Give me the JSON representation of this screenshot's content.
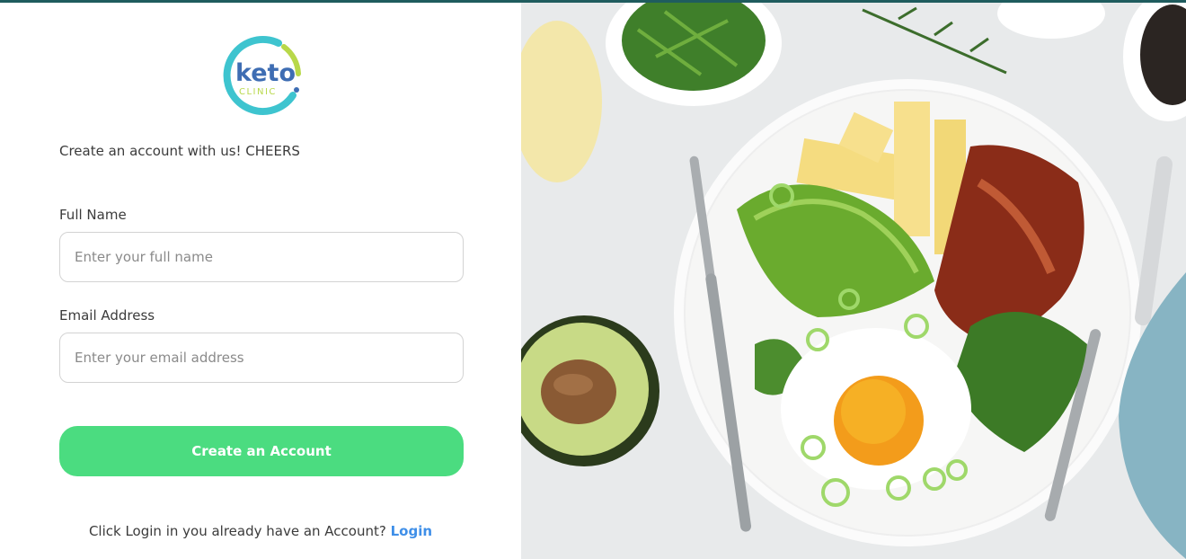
{
  "brand": {
    "name": "keto",
    "sub": "CLINIC"
  },
  "intro": "Create an account with us! CHEERS",
  "form": {
    "name_label": "Full Name",
    "name_placeholder": "Enter your full name",
    "email_label": "Email Address",
    "email_placeholder": "Enter your email address",
    "submit_label": "Create an Account"
  },
  "footer": {
    "text": "Click Login in you already have an Account?",
    "link": "Login"
  },
  "colors": {
    "accent": "#4bdc80",
    "link": "#3f8fe8",
    "logo_teal": "#3ec4cf",
    "logo_blue": "#3e6db3",
    "logo_green": "#b8d84a"
  },
  "hero": {
    "icon": "keto-meal-photo"
  }
}
